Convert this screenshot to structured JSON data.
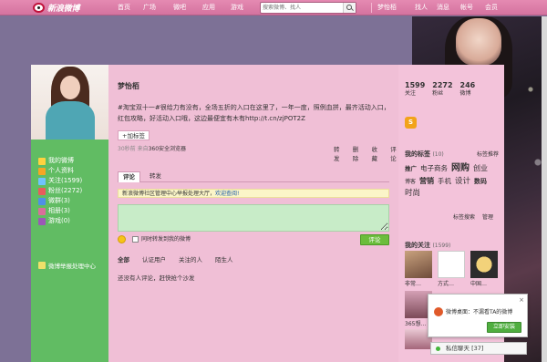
{
  "header": {
    "logo_text": "新浪微博",
    "nav": [
      "首页",
      "广场",
      "微吧",
      "应用",
      "游戏"
    ],
    "search_placeholder": "搜索微博、找人",
    "user_nav": [
      "梦怡栢",
      "找人",
      "消息",
      "帐号",
      "会员"
    ]
  },
  "profile": {
    "name": "梦怡栢",
    "post_text": "#淘宝双十一#很给力有没有，全场五折的入口在这里了，一年一度，照例血拼，最齐活动入口，红包攻略，好活动入口哦，这边最便宜有木有http://t.cn/zjPOT2Z",
    "add_tag_label": "+加标签",
    "time": "30秒前",
    "source_prefix": "来自",
    "source": "360安全浏览器",
    "actions": [
      "转发",
      "删除",
      "收藏",
      "评论"
    ]
  },
  "left_menu": [
    {
      "label": "我的微博",
      "icon": "home-icon",
      "color": "#ffd23f"
    },
    {
      "label": "个人资料",
      "icon": "profile-icon",
      "color": "#f5a623"
    },
    {
      "label": "关注(1599)",
      "icon": "follow-icon",
      "color": "#6fc2ff"
    },
    {
      "label": "粉丝(2272)",
      "icon": "fans-icon",
      "color": "#e85c5c"
    },
    {
      "label": "微群(3)",
      "icon": "group-icon",
      "color": "#4f8fe8"
    },
    {
      "label": "相册(3)",
      "icon": "album-icon",
      "color": "#d96e9a"
    },
    {
      "label": "游戏(0)",
      "icon": "game-icon",
      "color": "#9b59b6"
    }
  ],
  "left_report": "微博举报处理中心",
  "comment_section": {
    "tabs": [
      "评论",
      "转发"
    ],
    "notice": "新浪微博社区管理中心举报处理大厅，",
    "notice_link": "欢迎查阅!",
    "also_forward": "同时转发到我的微博",
    "comment_button": "评论",
    "filters": [
      "全部",
      "认证用户",
      "关注的人",
      "陌生人"
    ],
    "empty_text": "还没有人评论，赶快抢个沙发"
  },
  "stats": [
    {
      "num": "1599",
      "label": "关注"
    },
    {
      "num": "2272",
      "label": "粉丝"
    },
    {
      "num": "246",
      "label": "微博"
    }
  ],
  "badge_text": "S",
  "my_tags": {
    "heading": "我的标签",
    "count": "(10)",
    "recommend": "标签推荐",
    "items": [
      "推广",
      "电子商务",
      "网购",
      "创业",
      "博客",
      "营销",
      "手机",
      "设计",
      "数码",
      "时尚"
    ],
    "actions": [
      "标签搜索",
      "管理"
    ]
  },
  "my_follows": {
    "heading": "我的关注",
    "count": "(1599)",
    "names": [
      "非常…",
      "方式…",
      "中国…",
      "365想…"
    ]
  },
  "popup": {
    "close": "×",
    "text": "微博桌面：不漏看TA的微博",
    "button": "立即安装"
  },
  "chat": {
    "text": "私信聊天 [37]"
  }
}
